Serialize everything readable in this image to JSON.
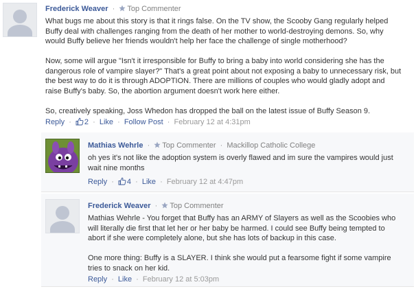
{
  "comments": [
    {
      "author": "Frederick Weaver",
      "badge": "Top Commenter",
      "paragraphs": [
        "What bugs me about this story is that it rings false. On the TV show, the Scooby Gang regularly helped Buffy deal with challenges ranging from the death of her mother to world-destroying demons. So, why would Buffy believe her friends wouldn't help her face the challenge of single motherhood?",
        "Now, some will argue \"Isn't it irresponsible for Buffy to bring a baby into world considering she has the dangerous role of vampire slayer?\" That's a great point about not exposing a baby to unnecessary risk, but the best way to do it is through ADOPTION. There are millions of couples who would gladly adopt and raise Buffy's baby. So, the abortion argument doesn't work here either.",
        "So, creatively speaking, Joss Whedon has dropped the ball on the latest issue of Buffy Season 9."
      ],
      "actions": {
        "reply": "Reply",
        "likes": "2",
        "like": "Like",
        "follow": "Follow Post",
        "timestamp": "February 12 at 4:31pm"
      }
    }
  ],
  "replies": [
    {
      "author": "Mathias Wehrle",
      "badge": "Top Commenter",
      "affiliation": "Mackillop Catholic College",
      "text": "oh yes it's not like the adoption system is overly flawed and im sure the vampires would just wait nine months",
      "actions": {
        "reply": "Reply",
        "likes": "4",
        "like": "Like",
        "timestamp": "February 12 at 4:47pm"
      }
    },
    {
      "author": "Frederick Weaver",
      "badge": "Top Commenter",
      "paragraphs": [
        "Mathias Wehrle - You forget that Buffy has an ARMY of Slayers as well as the Scoobies who will literally die first that let her or her baby be harmed. I could see Buffy being tempted to abort if she were completely alone, but she has lots of backup in this case.",
        "One more thing: Buffy is a SLAYER. I think she would put a fearsome fight if some vampire tries to snack on her kid."
      ],
      "actions": {
        "reply": "Reply",
        "like": "Like",
        "timestamp": "February 12 at 5:03pm"
      }
    }
  ],
  "colors": {
    "link": "#3b5998",
    "meta": "#999999",
    "text": "#333333",
    "reply_bg": "#f7f8fa"
  },
  "icons": {
    "badge": "star-icon",
    "like": "thumbs-up-icon",
    "avatar_default": "default-avatar-icon",
    "avatar_mathias": "purple-creature-avatar"
  }
}
